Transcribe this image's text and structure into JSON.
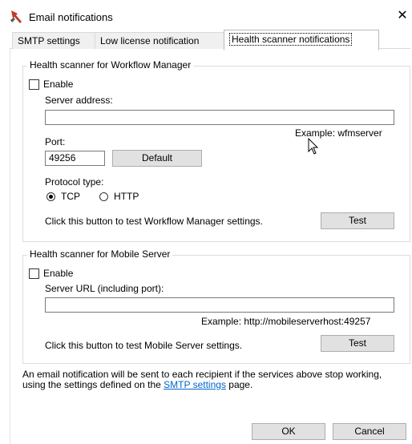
{
  "window": {
    "title": "Email notifications",
    "close_glyph": "✕",
    "icon": "tools-icon"
  },
  "tabs": [
    {
      "label": "SMTP settings"
    },
    {
      "label": "Low license notification"
    },
    {
      "label": "Health scanner notifications",
      "active": true
    }
  ],
  "workflow": {
    "group_title": "Health scanner for Workflow Manager",
    "enable_label": "Enable",
    "enable_checked": false,
    "server_address_label": "Server address:",
    "server_address_value": "",
    "server_example": "Example: wfmserver",
    "port_label": "Port:",
    "port_value": "49256",
    "default_button": "Default",
    "protocol_label": "Protocol type:",
    "protocol_options": [
      "TCP",
      "HTTP"
    ],
    "protocol_selected": "TCP",
    "test_text": "Click this button to test Workflow Manager settings.",
    "test_button": "Test"
  },
  "mobile": {
    "group_title": "Health scanner for Mobile Server",
    "enable_label": "Enable",
    "enable_checked": false,
    "server_url_label": "Server URL (including port):",
    "server_url_value": "",
    "url_example": "Example: http://mobileserverhost:49257",
    "test_text": "Click this button to test Mobile Server settings.",
    "test_button": "Test"
  },
  "footer": {
    "note_before": "An email notification will be sent to each recipient if the services above stop working, using the settings defined on the ",
    "note_link": "SMTP settings",
    "note_after": " page.",
    "ok_button": "OK",
    "cancel_button": "Cancel"
  },
  "colors": {
    "link": "#0066cc",
    "button_bg": "#e1e1e1",
    "border": "#dcdcdc"
  }
}
